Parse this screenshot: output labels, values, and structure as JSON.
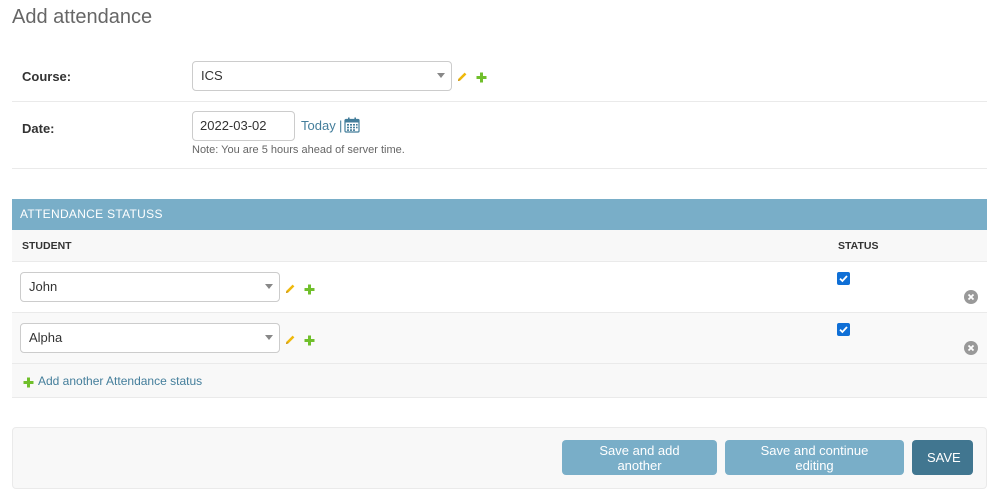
{
  "page": {
    "title": "Add attendance"
  },
  "course": {
    "label": "Course:",
    "value": "ICS"
  },
  "date": {
    "label": "Date:",
    "value": "2022-03-02",
    "today_label": "Today",
    "separator": "|",
    "help_text": "Note: You are 5 hours ahead of server time."
  },
  "inline": {
    "title": "ATTENDANCE STATUSS",
    "columns": {
      "student": "STUDENT",
      "status": "STATUS"
    },
    "rows": [
      {
        "student": "John",
        "status_checked": true
      },
      {
        "student": "Alpha",
        "status_checked": true
      }
    ],
    "add_another_label": "Add another Attendance status"
  },
  "submit": {
    "save_add_another": "Save and add another",
    "save_continue": "Save and continue editing",
    "save": "SAVE"
  },
  "colors": {
    "header_blue": "#79aec8",
    "save_blue": "#417690",
    "link_blue": "#447e9b",
    "edit_yellow": "#efb80b",
    "add_green": "#70bf2b",
    "checkbox_blue": "#0f6fd6"
  },
  "icons": [
    "pencil-icon",
    "plus-icon",
    "calendar-icon",
    "delete-x-icon",
    "chevron-down-icon",
    "checkmark-icon"
  ]
}
